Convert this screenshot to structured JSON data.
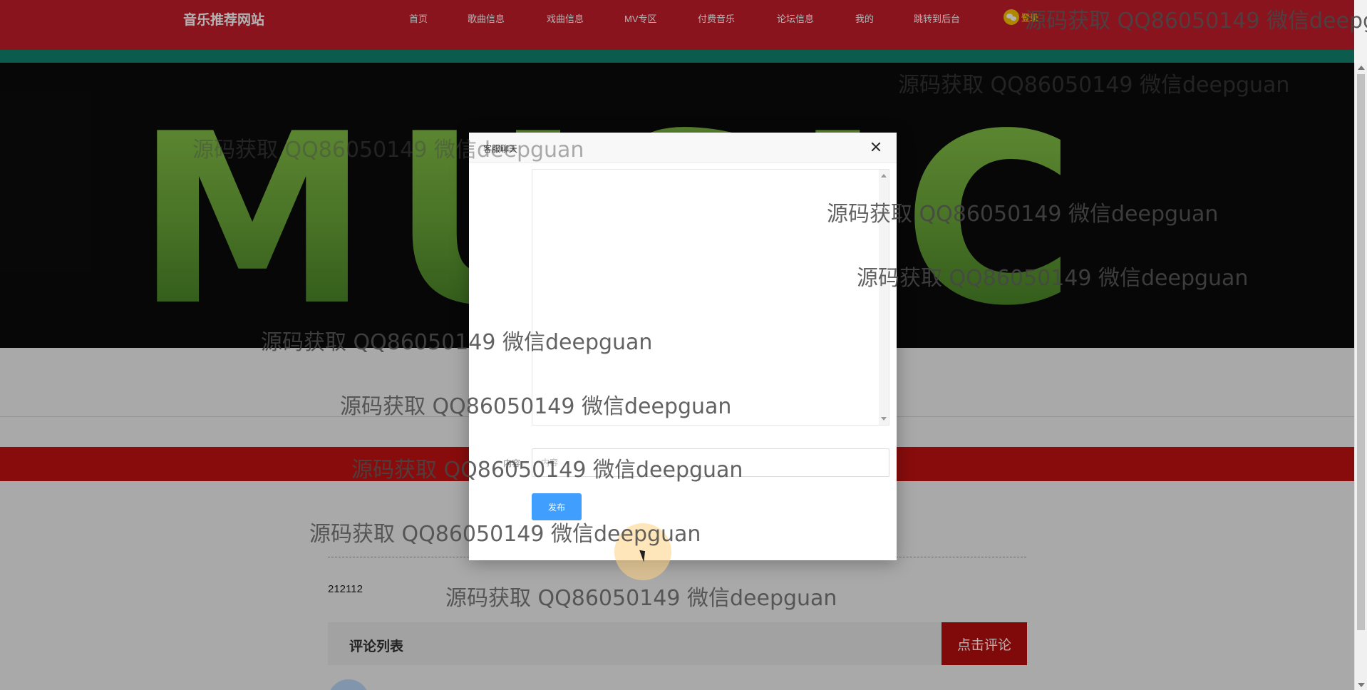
{
  "site": {
    "brand": "音乐推荐网站"
  },
  "nav": {
    "items": [
      "首页",
      "歌曲信息",
      "戏曲信息",
      "MV专区",
      "付费音乐",
      "论坛信息",
      "我的",
      "跳转到后台"
    ],
    "login_label": "登录"
  },
  "banner": {
    "text": "MUSIC"
  },
  "post": {
    "content": "212112"
  },
  "comments": {
    "title": "评论列表",
    "button_label": "点击评论"
  },
  "modal": {
    "title": "客服聊天",
    "message_label": "内容",
    "message_placeholder": "内容",
    "publish_label": "发布"
  },
  "watermark": {
    "text": "源码获取 QQ86050149 微信deepguan"
  },
  "colors": {
    "nav_red": "#c41e2c",
    "nav_strip": "#11846e",
    "accent_blue": "#409eff",
    "comment_red": "#b80f0f"
  }
}
